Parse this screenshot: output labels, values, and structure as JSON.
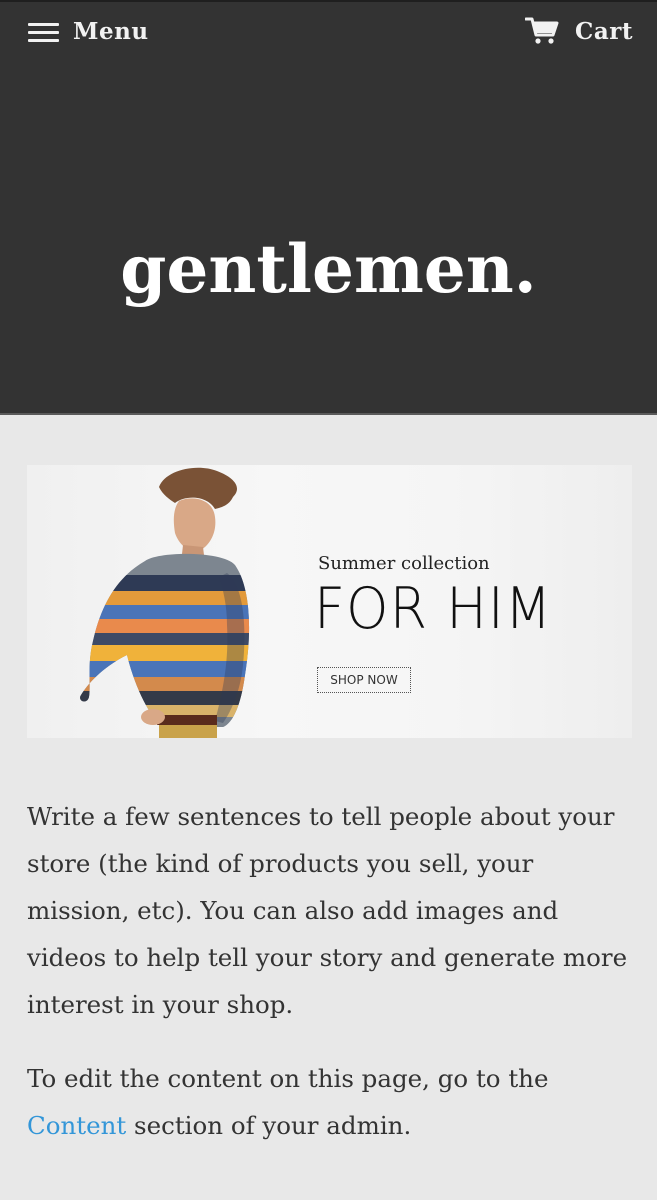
{
  "header": {
    "menu_label": "Menu",
    "cart_label": "Cart",
    "site_title": "gentlemen.",
    "background": "#333333"
  },
  "banner": {
    "subtitle": "Summer collection",
    "title": "FOR HIM",
    "button_label": "SHOP NOW"
  },
  "content": {
    "paragraph1": "Write a few sentences to tell people about your store (the kind of products you sell, your mission, etc). You can also add images and videos to help tell your story and generate more interest in your shop.",
    "paragraph2_before": "To edit the content on this page, go to the ",
    "link_label": "Content",
    "paragraph2_after": " section of your admin.",
    "link_color": "#3396d8"
  },
  "icons": {
    "menu": "hamburger-icon",
    "cart": "cart-icon"
  }
}
